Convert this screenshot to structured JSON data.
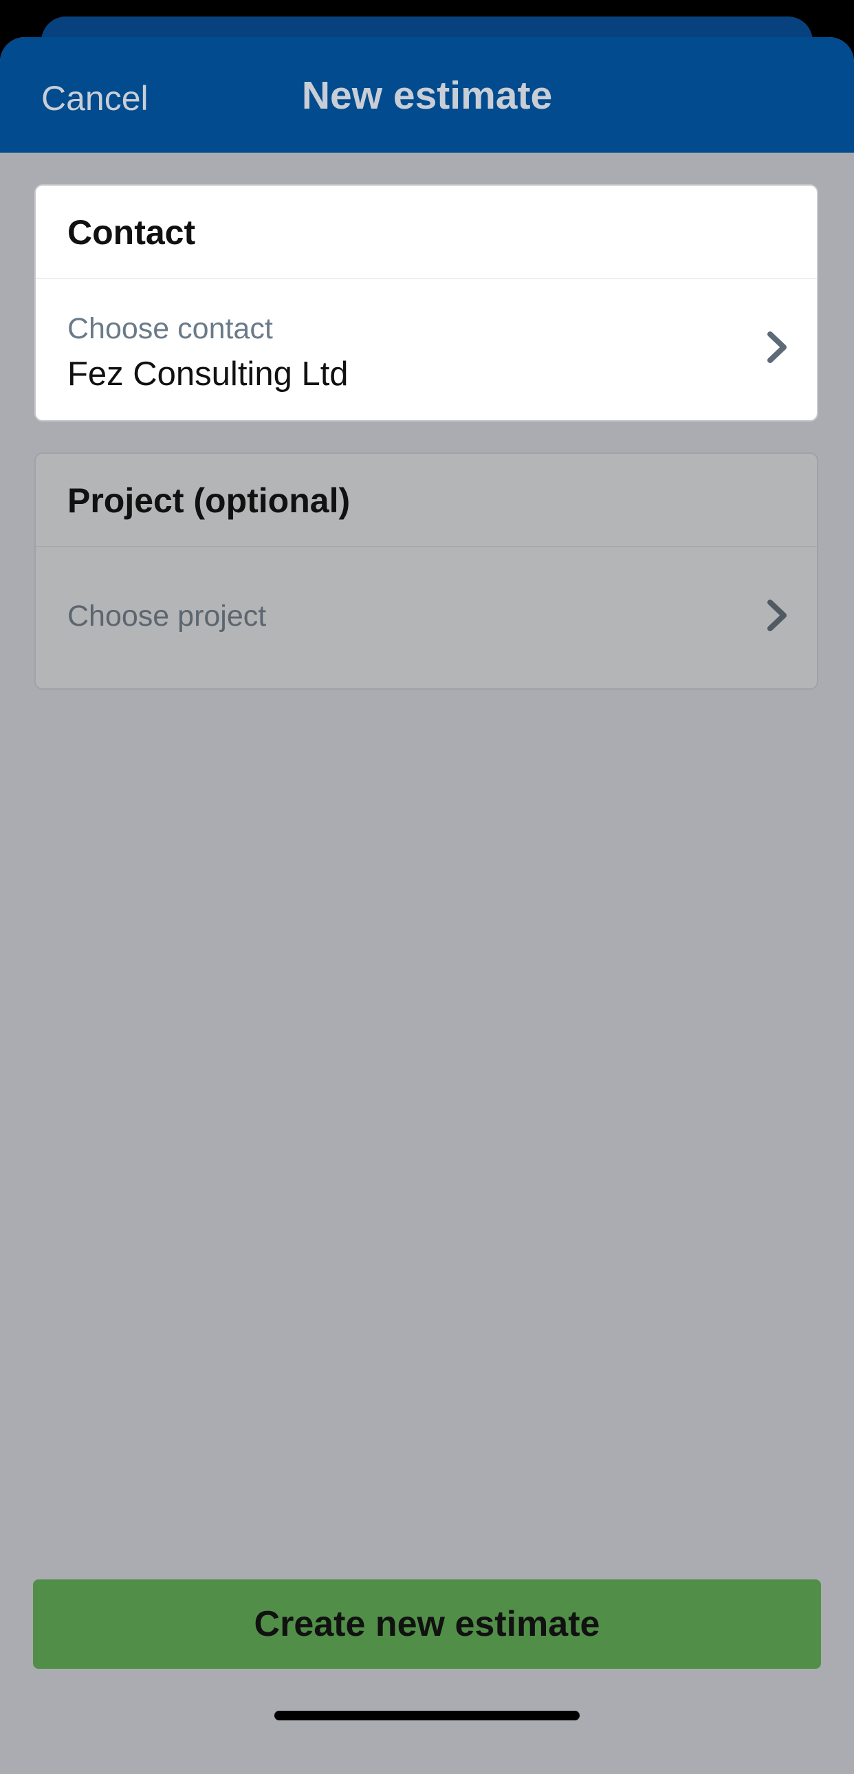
{
  "header": {
    "cancel_label": "Cancel",
    "title": "New estimate"
  },
  "contact": {
    "heading": "Contact",
    "field_label": "Choose contact",
    "field_value": "Fez Consulting Ltd"
  },
  "project": {
    "heading": "Project (optional)",
    "field_label": "Choose project"
  },
  "actions": {
    "create_label": "Create new estimate"
  },
  "icons": {
    "contact_chevron": "chevron-right-icon",
    "project_chevron": "chevron-right-icon"
  },
  "colors": {
    "header": "#014b8e",
    "backdrop": "#abacb1",
    "primary_button": "#518f48"
  }
}
